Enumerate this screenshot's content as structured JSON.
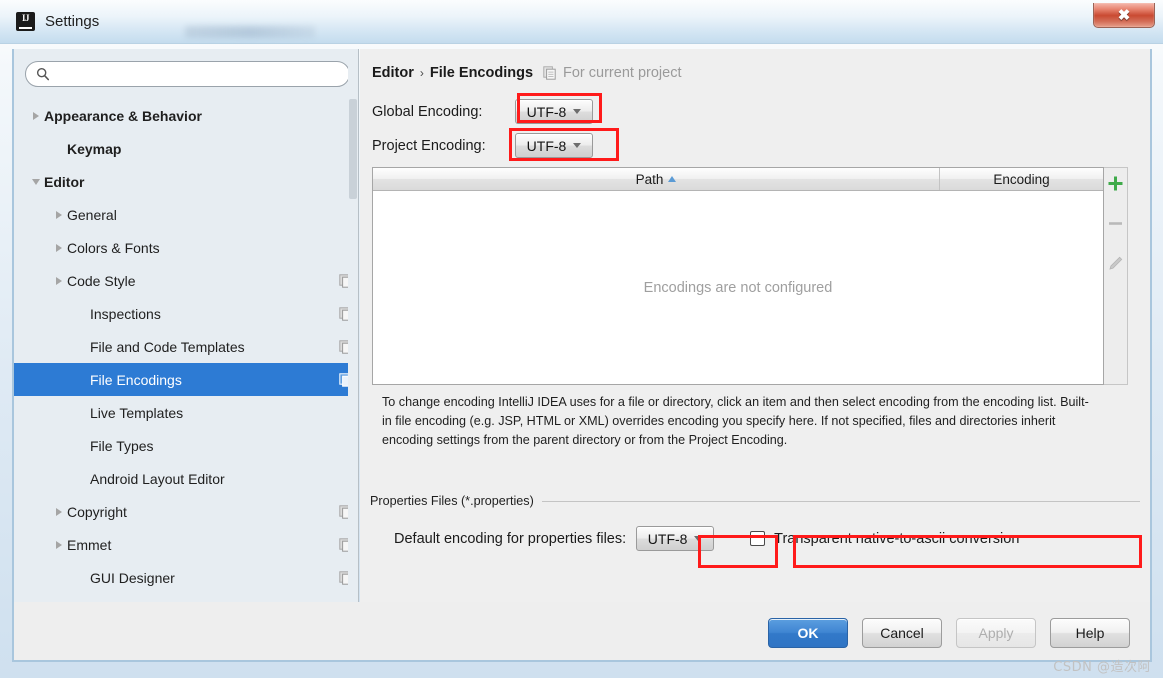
{
  "window": {
    "title": "Settings",
    "app_icon": "intellij-idea-icon",
    "close_label": "✖"
  },
  "sidebar": {
    "search": {
      "value": "",
      "placeholder": "",
      "icon": "search-icon"
    },
    "items": [
      {
        "label": "Appearance & Behavior",
        "indent": 0,
        "twisty": "right",
        "bold": true,
        "copy": false,
        "selected": false
      },
      {
        "label": "Keymap",
        "indent": 1,
        "twisty": "none",
        "bold": true,
        "copy": false,
        "selected": false
      },
      {
        "label": "Editor",
        "indent": 0,
        "twisty": "down",
        "bold": true,
        "copy": false,
        "selected": false
      },
      {
        "label": "General",
        "indent": 1,
        "twisty": "right",
        "bold": false,
        "copy": false,
        "selected": false
      },
      {
        "label": "Colors & Fonts",
        "indent": 1,
        "twisty": "right",
        "bold": false,
        "copy": false,
        "selected": false
      },
      {
        "label": "Code Style",
        "indent": 1,
        "twisty": "right",
        "bold": false,
        "copy": true,
        "selected": false
      },
      {
        "label": "Inspections",
        "indent": 2,
        "twisty": "none",
        "bold": false,
        "copy": true,
        "selected": false
      },
      {
        "label": "File and Code Templates",
        "indent": 2,
        "twisty": "none",
        "bold": false,
        "copy": true,
        "selected": false
      },
      {
        "label": "File Encodings",
        "indent": 2,
        "twisty": "none",
        "bold": false,
        "copy": true,
        "selected": true
      },
      {
        "label": "Live Templates",
        "indent": 2,
        "twisty": "none",
        "bold": false,
        "copy": false,
        "selected": false
      },
      {
        "label": "File Types",
        "indent": 2,
        "twisty": "none",
        "bold": false,
        "copy": false,
        "selected": false
      },
      {
        "label": "Android Layout Editor",
        "indent": 2,
        "twisty": "none",
        "bold": false,
        "copy": false,
        "selected": false
      },
      {
        "label": "Copyright",
        "indent": 1,
        "twisty": "right",
        "bold": false,
        "copy": true,
        "selected": false
      },
      {
        "label": "Emmet",
        "indent": 1,
        "twisty": "right",
        "bold": false,
        "copy": true,
        "selected": false
      },
      {
        "label": "GUI Designer",
        "indent": 2,
        "twisty": "none",
        "bold": false,
        "copy": true,
        "selected": false
      }
    ]
  },
  "main": {
    "breadcrumb": {
      "parent": "Editor",
      "separator": "›",
      "current": "File Encodings",
      "scope_icon": "copy-icon",
      "scope_note": "For current project"
    },
    "global_encoding": {
      "label": "Global Encoding:",
      "value": "UTF-8"
    },
    "project_encoding": {
      "label": "Project Encoding:",
      "value": "UTF-8"
    },
    "table": {
      "columns": [
        "Path",
        "Encoding"
      ],
      "sort_column": "Path",
      "sort_direction": "ascending",
      "rows": [],
      "empty_message": "Encodings are not configured"
    },
    "table_toolbar": [
      {
        "name": "add-button",
        "glyph": "+",
        "enabled": true
      },
      {
        "name": "remove-button",
        "glyph": "−",
        "enabled": false
      },
      {
        "name": "edit-button",
        "glyph": "pencil",
        "enabled": false
      }
    ],
    "help_text": "To change encoding IntelliJ IDEA uses for a file or directory, click an item and then select encoding from the encoding list. Built-in file encoding (e.g. JSP, HTML or XML) overrides encoding you specify here. If not specified, files and directories inherit encoding settings from the parent directory or from the Project Encoding.",
    "properties_group": {
      "title": "Properties Files (*.properties)",
      "default_encoding_label": "Default encoding for properties files:",
      "default_encoding_value": "UTF-8",
      "ascii_checkbox_label": "Transparent native-to-ascii conversion",
      "ascii_checkbox_checked": false
    }
  },
  "footer": {
    "buttons": [
      {
        "label": "OK",
        "style": "primary"
      },
      {
        "label": "Cancel",
        "style": "normal"
      },
      {
        "label": "Apply",
        "style": "disabled"
      },
      {
        "label": "Help",
        "style": "normal"
      }
    ]
  },
  "watermark": "CSDN @造次阿",
  "colors": {
    "selection_blue": "#2d7bd4",
    "primary_button": "#3279c9",
    "annotation_red": "#ff1a1a",
    "add_green": "#3faa4a",
    "sidebar_bg": "#e7edf2",
    "panel_bg": "#efefef"
  }
}
